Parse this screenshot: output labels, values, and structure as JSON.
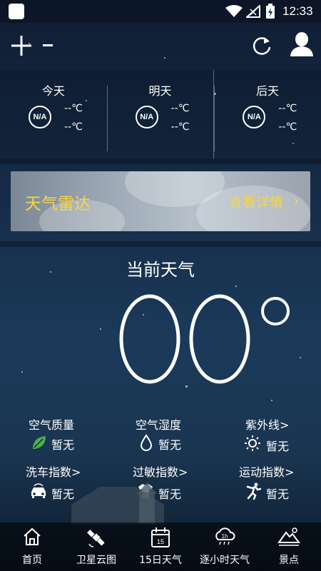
{
  "status_bar": {
    "time": "12:33"
  },
  "forecast": [
    {
      "day": "今天",
      "icon_text": "N/A",
      "high": "--℃",
      "low": "--℃"
    },
    {
      "day": "明天",
      "icon_text": "N/A",
      "high": "--℃",
      "low": "--℃"
    },
    {
      "day": "后天",
      "icon_text": "N/A",
      "high": "--℃",
      "low": "--℃"
    }
  ],
  "radar": {
    "title": "天气雷达",
    "link": "查看详情",
    "arrow": "›"
  },
  "current": {
    "title": "当前天气",
    "temp": "00",
    "unit": "°"
  },
  "indices": [
    {
      "label": "空气质量",
      "value": "暂无",
      "icon": "leaf-icon"
    },
    {
      "label": "空气湿度",
      "value": "暂无",
      "icon": "water-drop-icon"
    },
    {
      "label": "紫外线>",
      "value": "暂无",
      "icon": "sun-icon"
    },
    {
      "label": "洗车指数>",
      "value": "暂无",
      "icon": "car-icon"
    },
    {
      "label": "过敏指数>",
      "value": "暂无",
      "icon": "tshirt-icon"
    },
    {
      "label": "运动指数>",
      "value": "暂无",
      "icon": "running-person-icon"
    }
  ],
  "nav": [
    {
      "label": "首页",
      "icon": "home-icon",
      "active": true
    },
    {
      "label": "卫星云图",
      "icon": "satellite-icon"
    },
    {
      "label": "15日天气",
      "icon": "calendar-icon",
      "icon_text": "15"
    },
    {
      "label": "逐小时天气",
      "icon": "hourly-rain-icon",
      "icon_text": "1h"
    },
    {
      "label": "景点",
      "icon": "landscape-icon"
    }
  ],
  "colors": {
    "accent": "#f5d54a"
  }
}
